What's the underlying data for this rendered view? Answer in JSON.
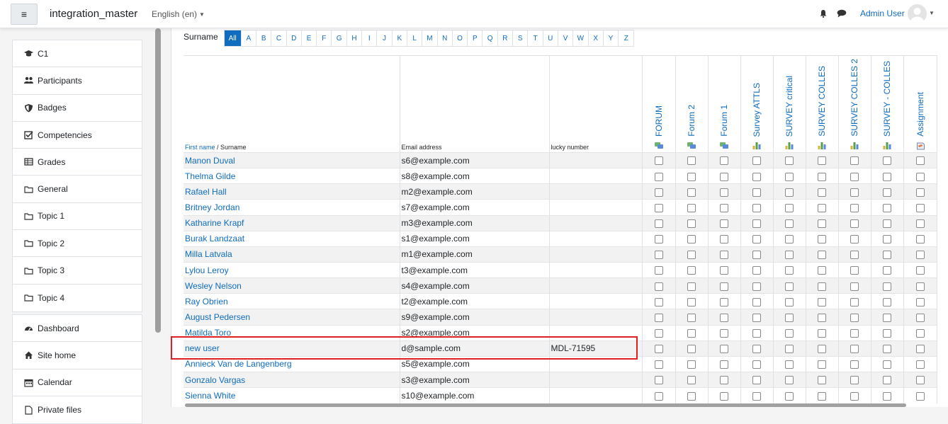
{
  "header": {
    "site_name": "integration_master",
    "language": "English (en)",
    "user_name": "Admin User"
  },
  "drawer": {
    "course_items": [
      {
        "label": "C1",
        "icon": "graduation-cap-icon"
      },
      {
        "label": "Participants",
        "icon": "users-icon"
      },
      {
        "label": "Badges",
        "icon": "shield-icon"
      },
      {
        "label": "Competencies",
        "icon": "checkbox-icon"
      },
      {
        "label": "Grades",
        "icon": "table-icon"
      },
      {
        "label": "General",
        "icon": "folder-icon"
      },
      {
        "label": "Topic 1",
        "icon": "folder-icon"
      },
      {
        "label": "Topic 2",
        "icon": "folder-icon"
      },
      {
        "label": "Topic 3",
        "icon": "folder-icon"
      },
      {
        "label": "Topic 4",
        "icon": "folder-icon"
      }
    ],
    "site_items": [
      {
        "label": "Dashboard",
        "icon": "dashboard-icon"
      },
      {
        "label": "Site home",
        "icon": "home-icon"
      },
      {
        "label": "Calendar",
        "icon": "calendar-icon"
      },
      {
        "label": "Private files",
        "icon": "file-icon"
      }
    ]
  },
  "filter": {
    "label": "Surname",
    "initials": [
      "All",
      "A",
      "B",
      "C",
      "D",
      "E",
      "F",
      "G",
      "H",
      "I",
      "J",
      "K",
      "L",
      "M",
      "N",
      "O",
      "P",
      "Q",
      "R",
      "S",
      "T",
      "U",
      "V",
      "W",
      "X",
      "Y",
      "Z"
    ],
    "selected": "All"
  },
  "table": {
    "col_name_first": "First name",
    "col_name_sep": " / Surname",
    "col_email": "Email address",
    "col_lucky": "lucky number",
    "modules": [
      {
        "label": "FORUM",
        "icon": "forum-icon"
      },
      {
        "label": "Forum 2",
        "icon": "forum-icon"
      },
      {
        "label": "Forum 1",
        "icon": "forum-icon"
      },
      {
        "label": "Survey ATTLS",
        "icon": "survey-icon"
      },
      {
        "label": "SURVEY critical",
        "icon": "survey-icon"
      },
      {
        "label": "SURVEY COLLES",
        "icon": "survey-icon"
      },
      {
        "label": "SURVEY COLLES 2",
        "icon": "survey-icon"
      },
      {
        "label": "SURVEY - COLLES",
        "icon": "survey-icon"
      },
      {
        "label": "Assignment",
        "icon": "assignment-icon"
      }
    ],
    "rows": [
      {
        "name": "Manon Duval",
        "email": "s6@example.com",
        "lucky": ""
      },
      {
        "name": "Thelma Gilde",
        "email": "s8@example.com",
        "lucky": ""
      },
      {
        "name": "Rafael Hall",
        "email": "m2@example.com",
        "lucky": ""
      },
      {
        "name": "Britney Jordan",
        "email": "s7@example.com",
        "lucky": ""
      },
      {
        "name": "Katharine Krapf",
        "email": "m3@example.com",
        "lucky": ""
      },
      {
        "name": "Burak Landzaat",
        "email": "s1@example.com",
        "lucky": ""
      },
      {
        "name": "Milla Latvala",
        "email": "m1@example.com",
        "lucky": ""
      },
      {
        "name": "Lylou Leroy",
        "email": "t3@example.com",
        "lucky": ""
      },
      {
        "name": "Wesley Nelson",
        "email": "s4@example.com",
        "lucky": ""
      },
      {
        "name": "Ray Obrien",
        "email": "t2@example.com",
        "lucky": ""
      },
      {
        "name": "August Pedersen",
        "email": "s9@example.com",
        "lucky": ""
      },
      {
        "name": "Matilda Toro",
        "email": "s2@example.com",
        "lucky": ""
      },
      {
        "name": "new user",
        "email": "d@sample.com",
        "lucky": "MDL-71595"
      },
      {
        "name": "Annieck Van de Langenberg",
        "email": "s5@example.com",
        "lucky": ""
      },
      {
        "name": "Gonzalo Vargas",
        "email": "s3@example.com",
        "lucky": ""
      },
      {
        "name": "Sienna White",
        "email": "s10@example.com",
        "lucky": ""
      }
    ]
  },
  "colors": {
    "accent": "#0f6cbf",
    "highlight": "#e02020"
  }
}
